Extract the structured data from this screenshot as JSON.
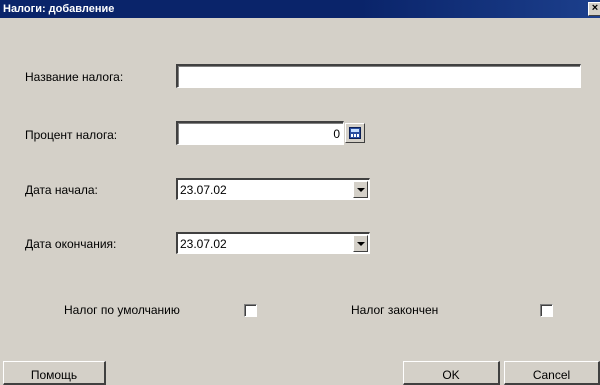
{
  "window": {
    "title": "Налоги: добавление",
    "close_glyph": "×"
  },
  "form": {
    "name_label": "Название налога:",
    "name_value": "",
    "percent_label": "Процент налога:",
    "percent_value": "0",
    "start_label": "Дата начала:",
    "start_value": "23.07.02",
    "end_label": "Дата окончания:",
    "end_value": "23.07.02",
    "default_label": "Налог по умолчанию",
    "default_checked": false,
    "finished_label": "Налог закончен",
    "finished_checked": false
  },
  "buttons": {
    "help": "Помощь",
    "ok": "OK",
    "cancel": "Cancel"
  },
  "icons": {
    "close": "close-icon",
    "calculator": "calculator-icon",
    "dropdown": "chevron-down-icon"
  },
  "colors": {
    "titlebar": "#0a246a",
    "face": "#d4d0c8",
    "field": "#ffffff"
  }
}
